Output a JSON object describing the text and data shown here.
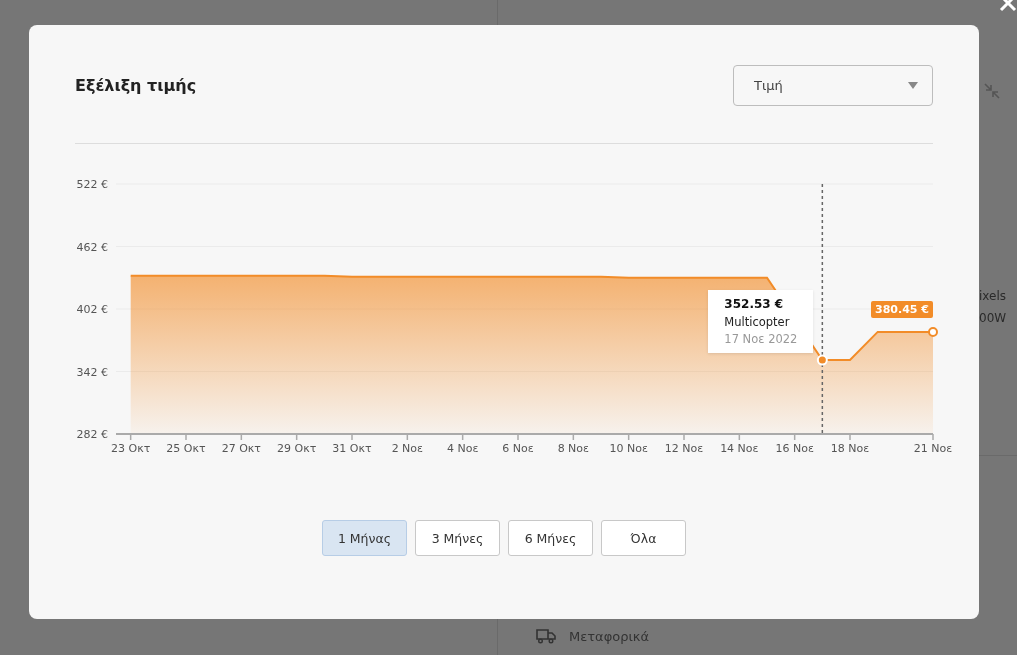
{
  "background": {
    "texts": [
      "ixels",
      "00W"
    ],
    "shipping": "Μεταφορικά"
  },
  "modal": {
    "title": "Εξέλιξη τιμής",
    "dropdown": {
      "value": "Τιμή"
    },
    "chart_data": {
      "type": "area",
      "ylim": [
        282,
        522
      ],
      "yticks": [
        {
          "value": 282,
          "label": "282 €"
        },
        {
          "value": 342,
          "label": "342 €"
        },
        {
          "value": 402,
          "label": "402 €"
        },
        {
          "value": 462,
          "label": "462 €"
        },
        {
          "value": 522,
          "label": "522 €"
        }
      ],
      "categories": [
        "23 Οκτ",
        null,
        "25 Οκτ",
        null,
        "27 Οκτ",
        null,
        "29 Οκτ",
        null,
        "31 Οκτ",
        null,
        "2 Νοε",
        null,
        "4 Νοε",
        null,
        "6 Νοε",
        null,
        "8 Νοε",
        null,
        "10 Νοε",
        null,
        "12 Νοε",
        null,
        "14 Νοε",
        null,
        "16 Νοε",
        null,
        "18 Νοε",
        null,
        null,
        "21 Νοε"
      ],
      "grid": true,
      "series": [
        {
          "color": "#f28c28",
          "values": [
            434,
            434,
            434,
            434,
            434,
            434,
            434,
            434,
            433,
            433,
            433,
            433,
            433,
            433,
            433,
            433,
            433,
            433,
            432,
            432,
            432,
            432,
            432,
            432,
            null,
            353,
            353,
            380,
            380,
            380
          ]
        }
      ],
      "annotations": [
        "380.45 €"
      ]
    },
    "tooltip": {
      "price": "352.53 €",
      "label": "Multicopter",
      "date": "17 Νοε 2022"
    },
    "ranges": [
      {
        "label": "1 Μήνας",
        "selected": true
      },
      {
        "label": "3 Μήνες",
        "selected": false
      },
      {
        "label": "6 Μήνες",
        "selected": false
      },
      {
        "label": "Όλα",
        "selected": false
      }
    ]
  }
}
